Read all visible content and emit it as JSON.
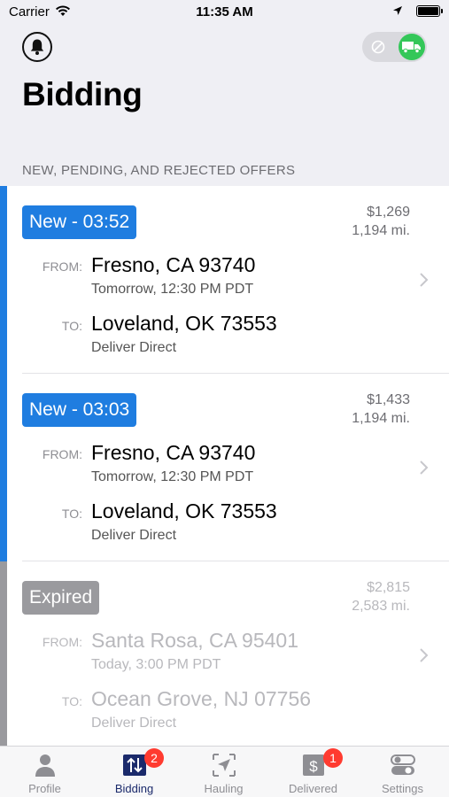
{
  "status_bar": {
    "carrier": "Carrier",
    "time": "11:35 AM"
  },
  "header": {
    "title": "Bidding",
    "section_header": "NEW, PENDING, AND REJECTED OFFERS"
  },
  "offers": [
    {
      "status": "New - 03:52",
      "status_color": "#1f7de0",
      "price": "$1,269",
      "miles": "1,194 mi.",
      "from_label": "FROM:",
      "from_city": "Fresno, CA 93740",
      "from_time": "Tomorrow, 12:30 PM PDT",
      "to_label": "TO:",
      "to_city": "Loveland, OK 73553",
      "to_detail": "Deliver Direct"
    },
    {
      "status": "New - 03:03",
      "status_color": "#1f7de0",
      "price": "$1,433",
      "miles": "1,194 mi.",
      "from_label": "FROM:",
      "from_city": "Fresno, CA 93740",
      "from_time": "Tomorrow, 12:30 PM PDT",
      "to_label": "TO:",
      "to_city": "Loveland, OK 73553",
      "to_detail": "Deliver Direct"
    },
    {
      "status": "Expired",
      "status_color": "#9a9a9e",
      "price": "$2,815",
      "miles": "2,583 mi.",
      "from_label": "FROM:",
      "from_city": "Santa Rosa, CA 95401",
      "from_time": "Today, 3:00 PM PDT",
      "to_label": "TO:",
      "to_city": "Ocean Grove, NJ 07756",
      "to_detail": "Deliver Direct"
    }
  ],
  "tabbar": {
    "tabs": [
      {
        "label": "Profile",
        "icon": "person-icon",
        "badge": ""
      },
      {
        "label": "Bidding",
        "icon": "bidding-arrows-icon",
        "badge": "2"
      },
      {
        "label": "Hauling",
        "icon": "navigation-arrow-icon",
        "badge": ""
      },
      {
        "label": "Delivered",
        "icon": "dollar-icon",
        "badge": "1"
      },
      {
        "label": "Settings",
        "icon": "toggles-icon",
        "badge": ""
      }
    ]
  },
  "colors": {
    "accent_blue": "#1f7de0",
    "accent_gray": "#9a9a9e",
    "active_tab": "#1b2a6b",
    "toggle_on": "#34c759",
    "badge_red": "#ff3b30"
  }
}
